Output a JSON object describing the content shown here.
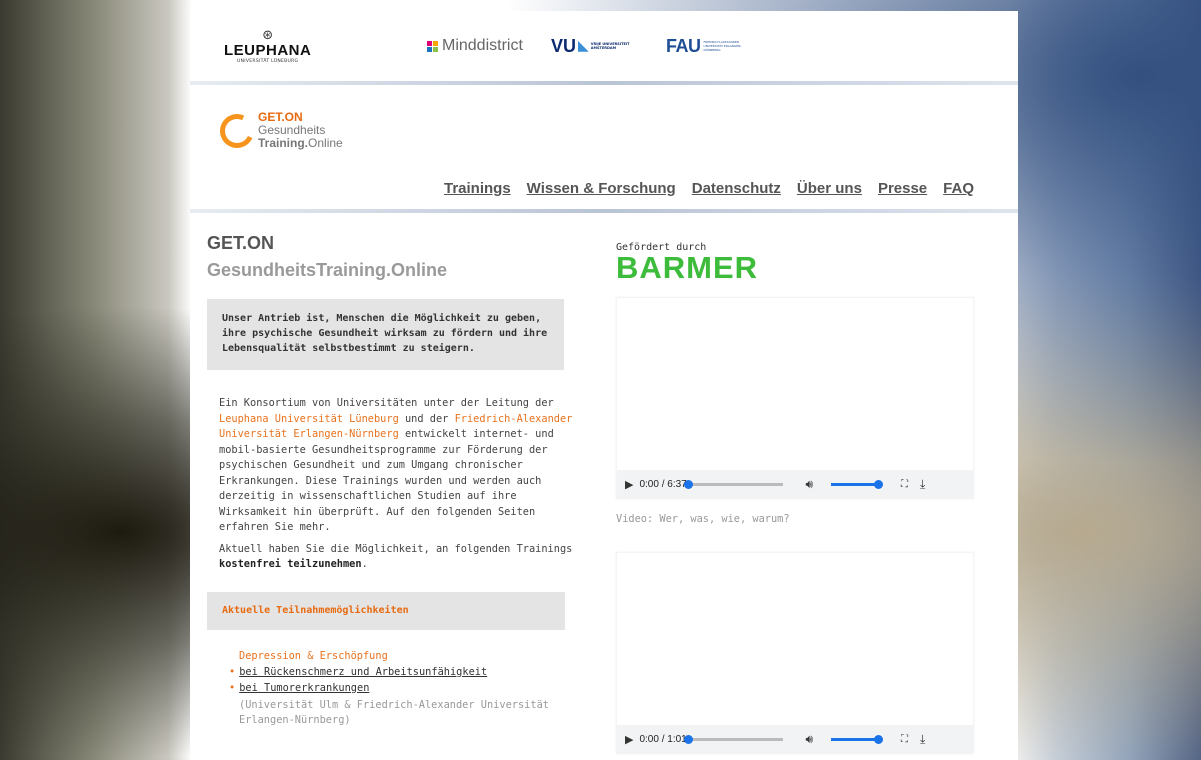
{
  "partners": {
    "leuphana_name": "LEUPHANA",
    "leuphana_sub": "UNIVERSITÄT LÜNEBURG",
    "minddistrict": "Minddistrict",
    "vu_big": "VU",
    "vu_small": "VRIJE UNIVERSITEIT AMSTERDAM",
    "fau_big": "FAU",
    "fau_small": "FRIEDRICH-ALEXANDER UNIVERSITÄT ERLANGEN-NÜRNBERG"
  },
  "logo": {
    "line1": "GET.ON",
    "line2": "Gesundheits",
    "line3a": "Training.",
    "line3b": "Online"
  },
  "nav": [
    "Trainings",
    "Wissen & Forschung",
    "Datenschutz",
    "Über uns",
    "Presse",
    "FAQ"
  ],
  "main": {
    "title1": "GET.ON",
    "title2": "GesundheitsTraining.Online",
    "quote": "Unser Antrieb ist, Menschen die Möglichkeit zu geben, ihre psychische Gesundheit wirksam zu fördern und ihre Lebensqualität selbstbestimmt zu steigern.",
    "para_a": "Ein Konsortium von Universitäten unter der Leitung der ",
    "para_link1": "Leuphana Universität Lüneburg",
    "para_b": " und der ",
    "para_link2": "Friedrich-Alexander Universität Erlangen-Nürnberg",
    "para_c": " entwickelt internet- und mobil-basierte Gesundheitsprogramme zur Förderung der psychischen Gesundheit und zum Umgang chronischer Erkrankungen. Diese Trainings wurden und werden auch derzeitig in wissenschaftlichen Studien auf ihre Wirksamkeit hin überprüft. Auf den folgenden Seiten erfahren Sie mehr.",
    "para2_a": "Aktuell haben Sie die Möglichkeit, an folgenden Trainings ",
    "para2_bold": "kostenfrei teilzunehmen",
    "para2_end": ".",
    "opps_title": "Aktuelle Teilnahmemöglichkeiten",
    "category": "Depression & Erschöpfung",
    "items": [
      "bei Rückenschmerz und Arbeitsunfähigkeit",
      "bei Tumorerkrankungen"
    ],
    "note": "(Universität Ulm & Friedrich-Alexander Universität Erlangen-Nürnberg)"
  },
  "sidebar": {
    "sponsor_label": "Gefördert durch",
    "sponsor": "BARMER",
    "video1_time": "0:00 / 6:37",
    "video1_caption": "Video: Wer, was, wie, warum?",
    "video2_time": "0:00 / 1:01"
  },
  "video_progress": {
    "video1": 0.0,
    "video2": 0.0
  },
  "colors": {
    "accent": "#e86a10",
    "barmer": "#3dbb3a",
    "player_blue": "#1a73e8"
  }
}
